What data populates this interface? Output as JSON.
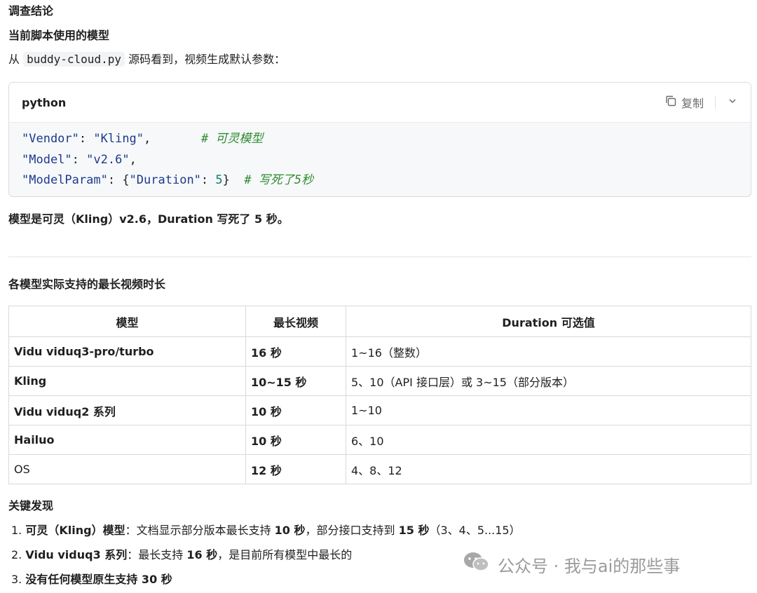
{
  "heading_conclusion": "调查结论",
  "heading_current_model": "当前脚本使用的模型",
  "intro": {
    "prefix": "从",
    "filename": "buddy-cloud.py",
    "suffix": "源码看到，视频生成默认参数："
  },
  "code_block": {
    "language": "python",
    "copy_label": "复制",
    "lines": [
      {
        "key": "\"Vendor\"",
        "value": "\"Kling\"",
        "trail": ",",
        "comment": "# 可灵模型"
      },
      {
        "key": "\"Model\"",
        "value": "\"v2.6\"",
        "trail": ",",
        "comment": ""
      },
      {
        "key": "\"ModelParam\"",
        "value_prefix": "{",
        "inner_key": "\"Duration\"",
        "inner_value": "5",
        "value_suffix": "}",
        "comment": "# 写死了5秒"
      }
    ]
  },
  "summary": "模型是可灵（Kling）v2.6，Duration 写死了 5 秒。",
  "heading_max_duration": "各模型实际支持的最长视频时长",
  "table": {
    "headers": [
      "模型",
      "最长视频",
      "Duration 可选值"
    ],
    "rows": [
      [
        "Vidu viduq3-pro/turbo",
        "16 秒",
        "1~16（整数）"
      ],
      [
        "Kling",
        "10~15 秒",
        "5、10（API 接口层）或 3~15（部分版本）"
      ],
      [
        "Vidu viduq2 系列",
        "10 秒",
        "1~10"
      ],
      [
        "Hailuo",
        "10 秒",
        "6、10"
      ],
      [
        "OS",
        "12 秒",
        "4、8、12"
      ]
    ]
  },
  "heading_findings": "关键发现",
  "findings": [
    {
      "num": "1.",
      "bold": "可灵（Kling）模型",
      "rest_a": "：文档显示部分版本最长支持 ",
      "bold2": "10 秒",
      "rest_b": "，部分接口支持到 ",
      "bold3": "15 秒",
      "rest_c": "（3、4、5...15）"
    },
    {
      "num": "2.",
      "bold": "Vidu viduq3 系列",
      "rest_a": "：最长支持 ",
      "bold2": "16 秒",
      "rest_b": "，是目前所有模型中最长的",
      "bold3": "",
      "rest_c": ""
    },
    {
      "num": "3.",
      "bold": "没有任何模型原生支持 30 秒",
      "rest_a": "",
      "bold2": "",
      "rest_b": "",
      "bold3": "",
      "rest_c": ""
    }
  ],
  "watermark": "公众号 · 我与ai的那些事",
  "colors": {
    "code_string": "#1b3a8c",
    "code_comment": "#2e8b2e",
    "code_number": "#0f7c6d"
  }
}
